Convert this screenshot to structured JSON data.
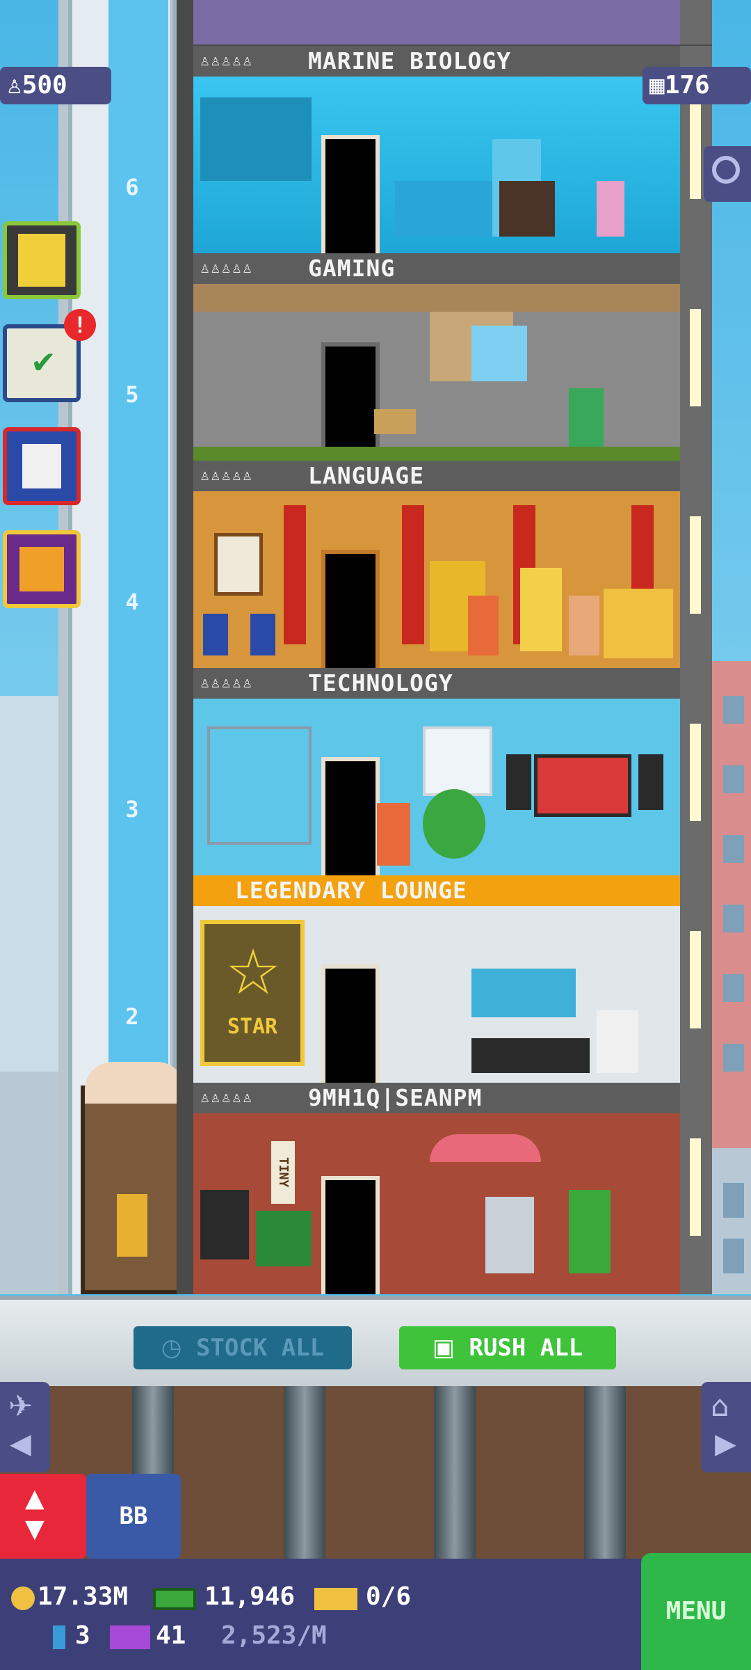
{
  "resources": {
    "population": "500",
    "floor_count": "176"
  },
  "elevator": {
    "floor_numbers": [
      "6",
      "5",
      "4",
      "3",
      "2"
    ]
  },
  "floors": [
    {
      "name": "MARINE BIOLOGY",
      "category": "aquarium",
      "stars": "♙♙♙♙♙"
    },
    {
      "name": "GAMING",
      "category": "gaming",
      "stars": "♙♙♙♙♙"
    },
    {
      "name": "LANGUAGE",
      "category": "language",
      "stars": "♙♙♙♙♙"
    },
    {
      "name": "TECHNOLOGY",
      "category": "technology",
      "stars": "♙♙♙♙♙"
    },
    {
      "name": "LEGENDARY LOUNGE",
      "category": "lounge",
      "stars": ""
    },
    {
      "name": "9MH1Q|SEANPM",
      "category": "lobby-residence",
      "stars": "♙♙♙♙♙"
    }
  ],
  "lounge": {
    "sign": "STAR"
  },
  "residence": {
    "sign": "TINY"
  },
  "actions": {
    "stock_all": "STOCK ALL",
    "rush_all": "RUSH ALL"
  },
  "controls": {
    "elevator_label": "BB",
    "menu_label": "MENU"
  },
  "hud": {
    "coins": "17.33M",
    "bux": "11,946",
    "tickets": "0/6",
    "keys": "3",
    "vip": "41",
    "income": "2,523/M"
  },
  "colors": {
    "menu_green": "#2fb84a",
    "rush_green": "#3ec33a",
    "stock_teal": "#206a8a",
    "hud_bg": "#3d4078",
    "legendary_gold": "#f3a10e"
  }
}
